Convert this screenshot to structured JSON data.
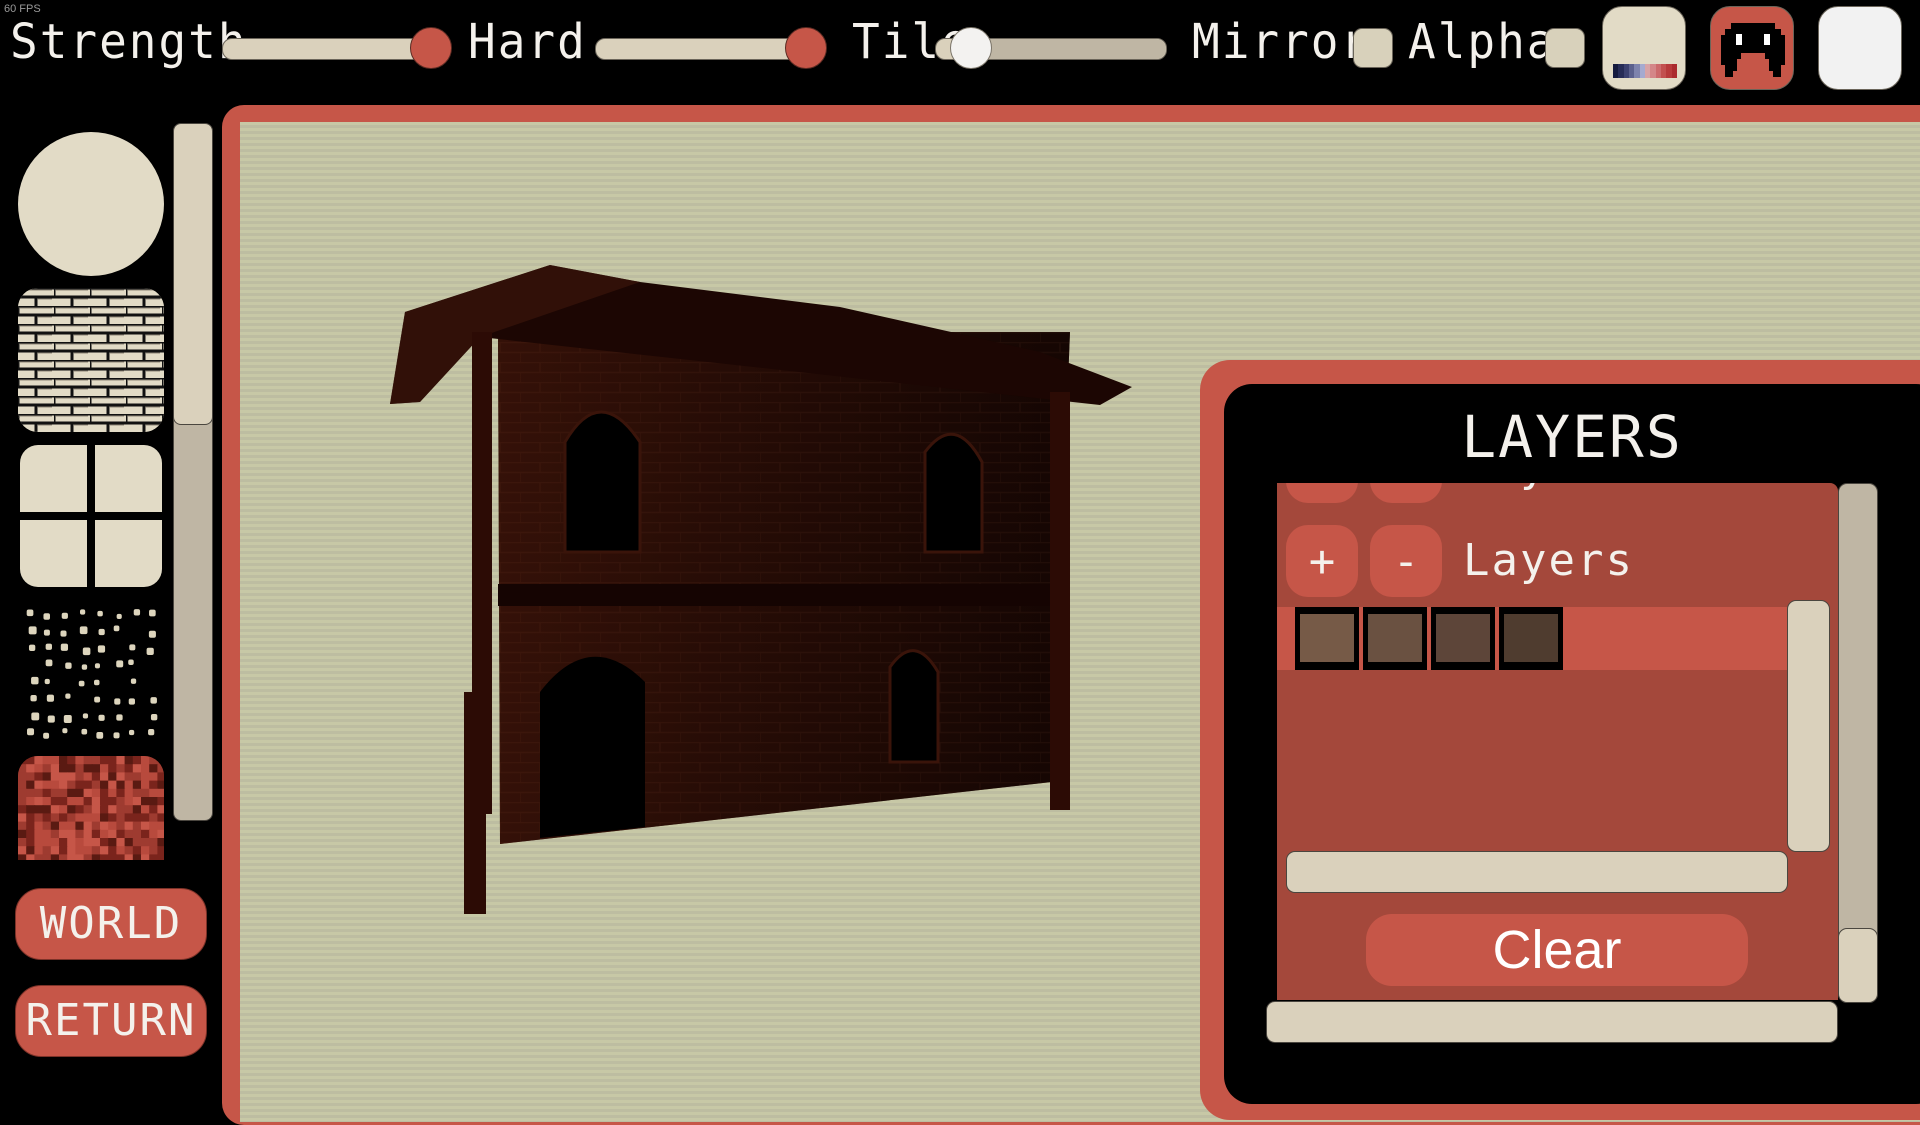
{
  "status": {
    "fps": "60 FPS"
  },
  "toolbar": {
    "strength": {
      "label": "Strength",
      "value": 1.0
    },
    "hard": {
      "label": "Hard",
      "value": 1.0
    },
    "tile": {
      "label": "Tile",
      "value": 0.05
    },
    "mirror": {
      "label": "Mirror",
      "checked": false
    },
    "alpha": {
      "label": "Alpha",
      "checked": false
    },
    "buttons": [
      {
        "name": "palette-button",
        "icon": "color-palette-icon"
      },
      {
        "name": "ghost-button",
        "icon": "ghost-monster-icon"
      },
      {
        "name": "color-swatch-button",
        "icon": "blank-swatch-icon"
      }
    ],
    "palette_colors": [
      "#151a3e",
      "#272c57",
      "#3c4170",
      "#5b608d",
      "#7e83ad",
      "#a5aad0",
      "#d8a3a6",
      "#d48688",
      "#cc6a6c",
      "#c2504f",
      "#b73a3b",
      "#ab2a2e"
    ]
  },
  "sidebar": {
    "brushes": [
      {
        "name": "circle-brush",
        "icon": "circle-icon"
      },
      {
        "name": "brick-brush",
        "icon": "brick-pattern-icon"
      },
      {
        "name": "tile-grid-brush",
        "icon": "grid-icon"
      },
      {
        "name": "dots-brush",
        "icon": "dots-pattern-icon"
      },
      {
        "name": "noise-brush",
        "icon": "noise-texture-icon"
      }
    ],
    "world_label": "WORLD",
    "return_label": "RETURN"
  },
  "canvas": {
    "subject": "brick-house-drawing"
  },
  "layers_panel": {
    "title": "LAYERS",
    "partial_row_label": "Layer",
    "row_label": "Layers",
    "add_label": "+",
    "remove_label": "-",
    "layer_swatches": [
      "#765a47",
      "#6a5141",
      "#5d4539",
      "#4f3c2f"
    ],
    "clear_label": "Clear"
  },
  "colors": {
    "accent_red": "#c65648",
    "panel_red": "#a4483b",
    "cream": "#e2dbc6",
    "track": "#dad1bc",
    "canvas_bg": "#c7c8a6"
  }
}
